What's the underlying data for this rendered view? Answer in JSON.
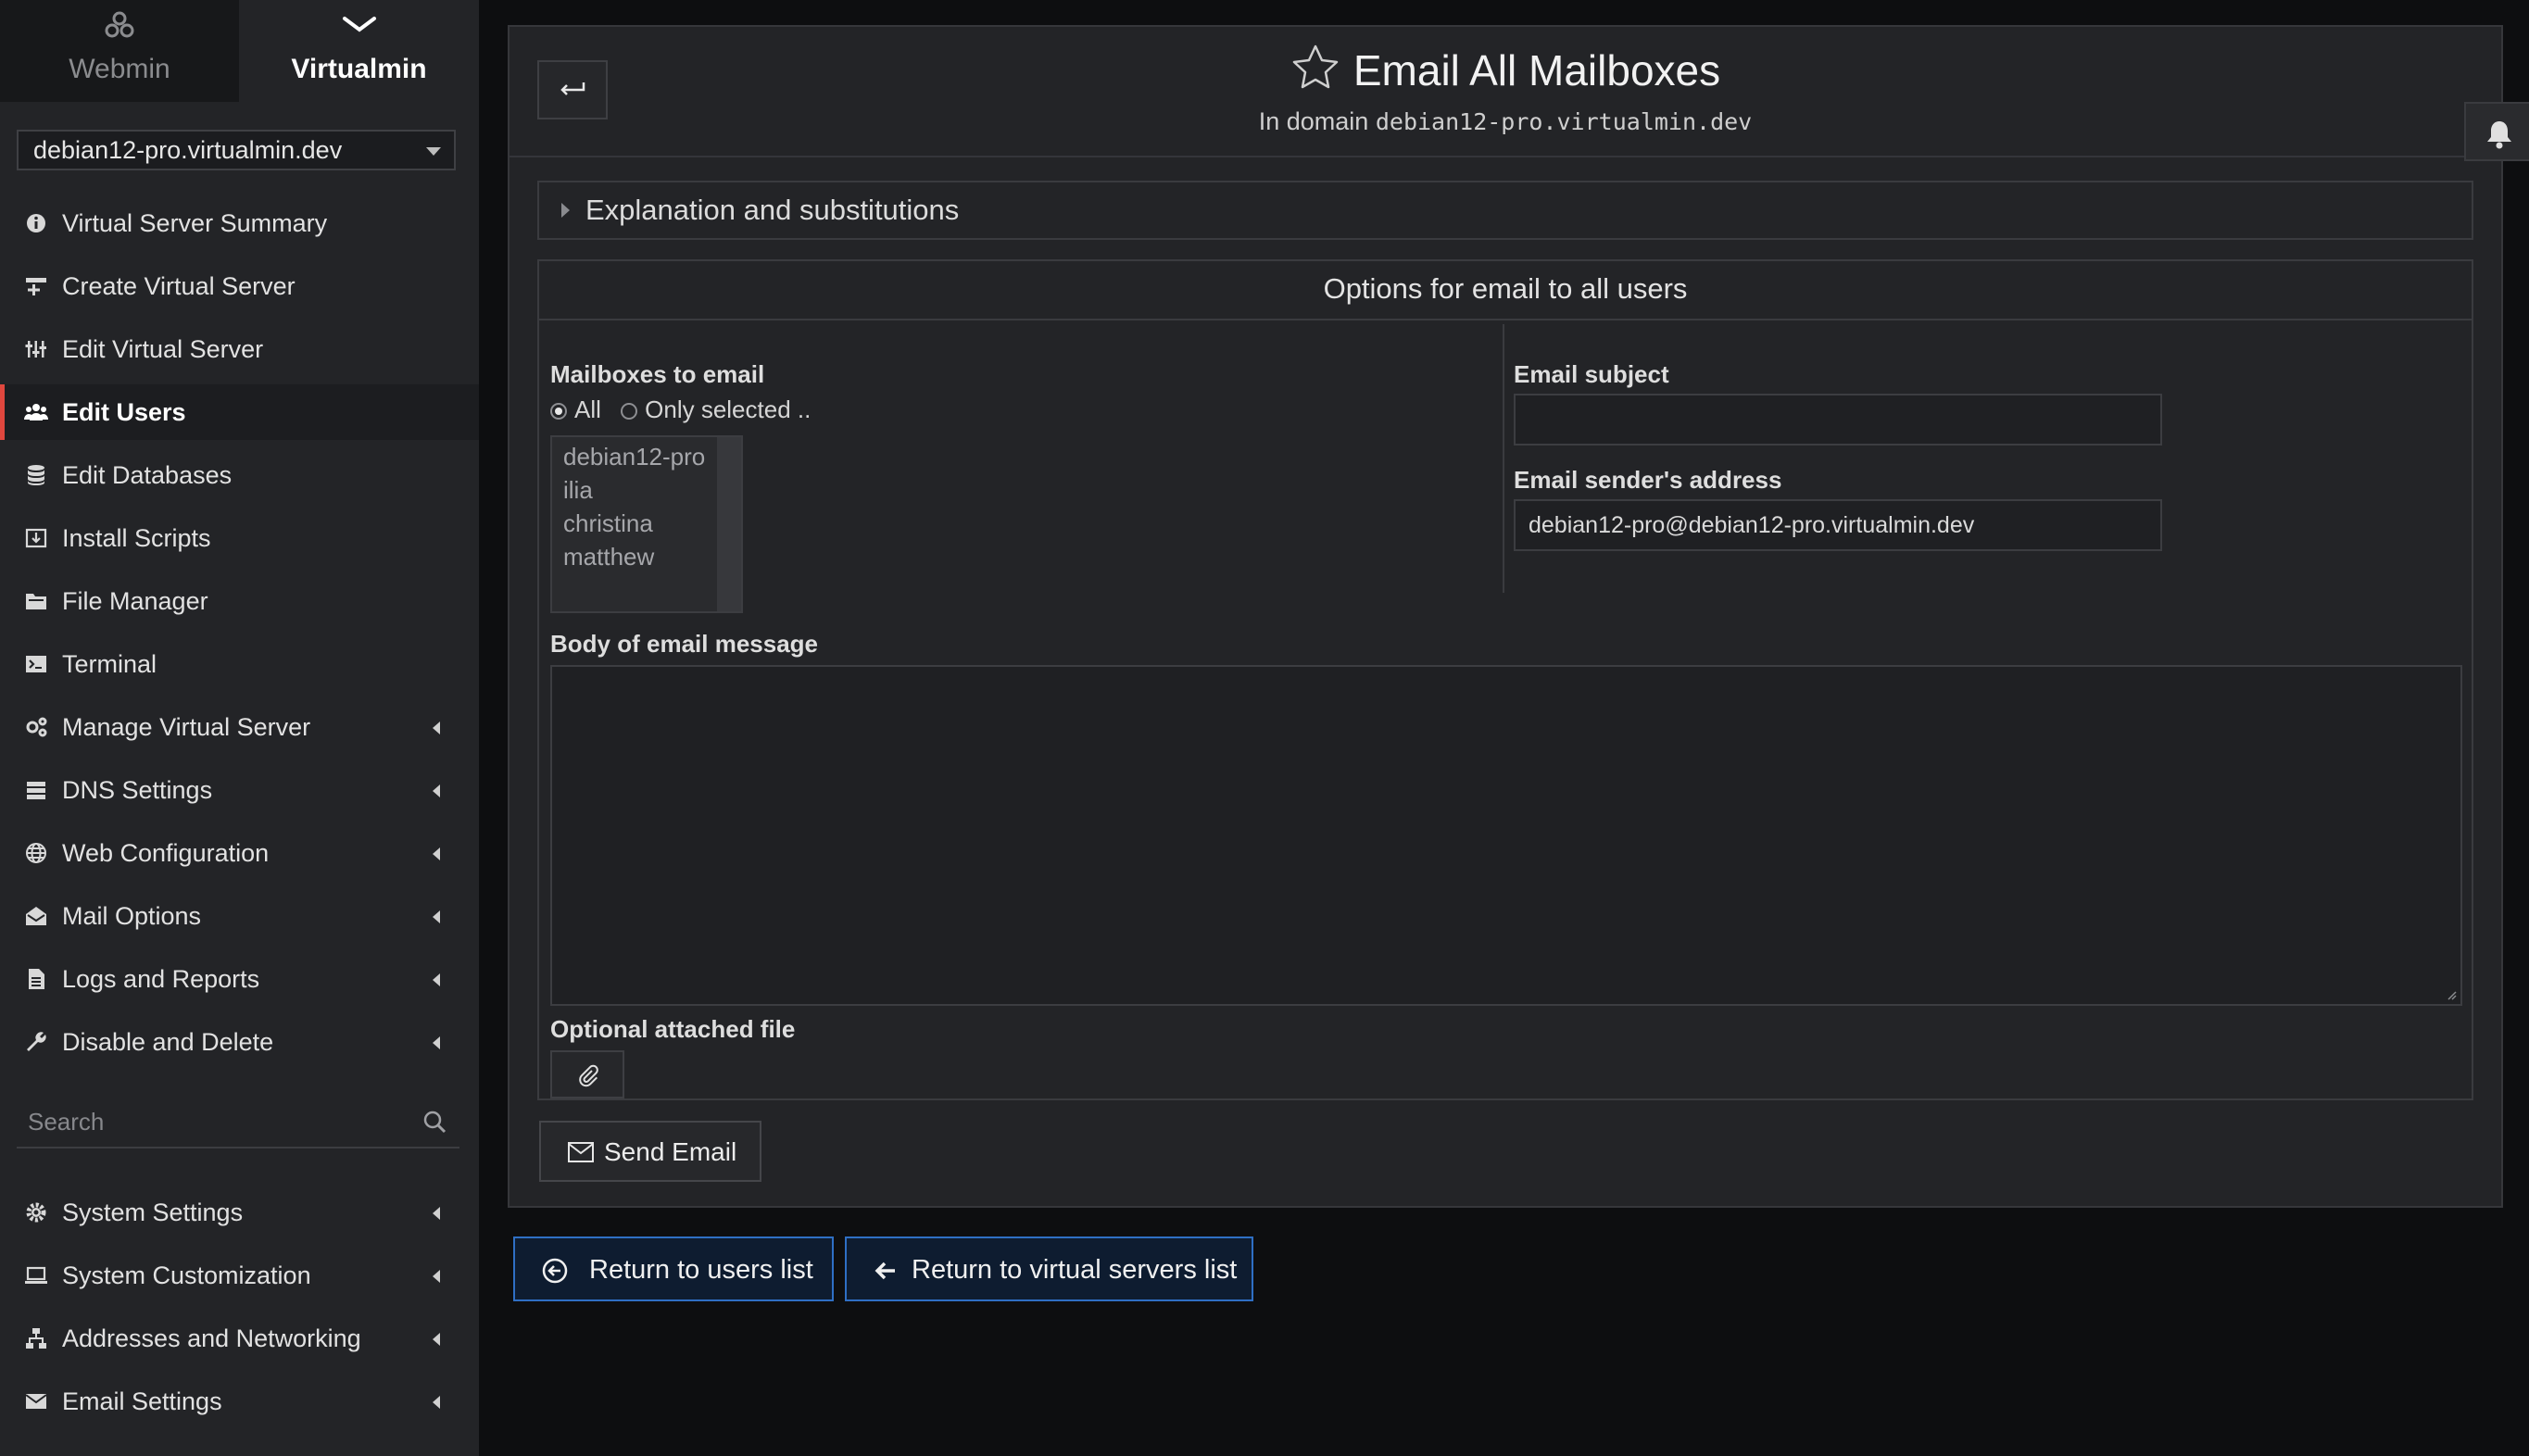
{
  "switcher": {
    "webmin_label": "Webmin",
    "virtualmin_label": "Virtualmin"
  },
  "domain_select": {
    "value": "debian12-pro.virtualmin.dev"
  },
  "nav": {
    "items": [
      {
        "label": "Virtual Server Summary",
        "icon": "info-icon"
      },
      {
        "label": "Create Virtual Server",
        "icon": "create-server-icon"
      },
      {
        "label": "Edit Virtual Server",
        "icon": "sliders-icon"
      },
      {
        "label": "Edit Users",
        "icon": "users-icon",
        "active": true
      },
      {
        "label": "Edit Databases",
        "icon": "database-icon"
      },
      {
        "label": "Install Scripts",
        "icon": "install-icon"
      },
      {
        "label": "File Manager",
        "icon": "folder-icon"
      },
      {
        "label": "Terminal",
        "icon": "terminal-icon"
      },
      {
        "label": "Manage Virtual Server",
        "icon": "cogs-icon"
      },
      {
        "label": "DNS Settings",
        "icon": "server-icon"
      },
      {
        "label": "Web Configuration",
        "icon": "globe-icon"
      },
      {
        "label": "Mail Options",
        "icon": "envelope-open-icon"
      },
      {
        "label": "Logs and Reports",
        "icon": "file-icon"
      },
      {
        "label": "Disable and Delete",
        "icon": "wrench-icon"
      }
    ],
    "search_placeholder": "Search",
    "bottom_items": [
      {
        "label": "System Settings",
        "icon": "gear-icon"
      },
      {
        "label": "System Customization",
        "icon": "laptop-icon"
      },
      {
        "label": "Addresses and Networking",
        "icon": "network-icon"
      },
      {
        "label": "Email Settings",
        "icon": "envelope-icon"
      }
    ]
  },
  "page": {
    "title": "Email All Mailboxes",
    "subtitle_prefix": "In domain",
    "subtitle_domain": "debian12-pro.virtualmin.dev"
  },
  "explanation": {
    "label": "Explanation and substitutions"
  },
  "form": {
    "section_title": "Options for email to all users",
    "mailboxes_label": "Mailboxes to email",
    "radio_all": "All",
    "radio_selected": "Only selected ..",
    "mailboxes": [
      "debian12-pro",
      "ilia",
      "christina",
      "matthew"
    ],
    "subject_label": "Email subject",
    "subject_value": "",
    "sender_label": "Email sender's address",
    "sender_value": "debian12-pro@debian12-pro.virtualmin.dev",
    "body_label": "Body of email message",
    "body_value": "",
    "attach_label": "Optional attached file",
    "send_label": "Send Email"
  },
  "footer": {
    "return_users": "Return to users list",
    "return_servers": "Return to virtual servers list"
  },
  "colors": {
    "accent_active": "#e0473e",
    "return_border": "#2f6fc4",
    "background": "#0d0e10",
    "panel": "#232427"
  }
}
